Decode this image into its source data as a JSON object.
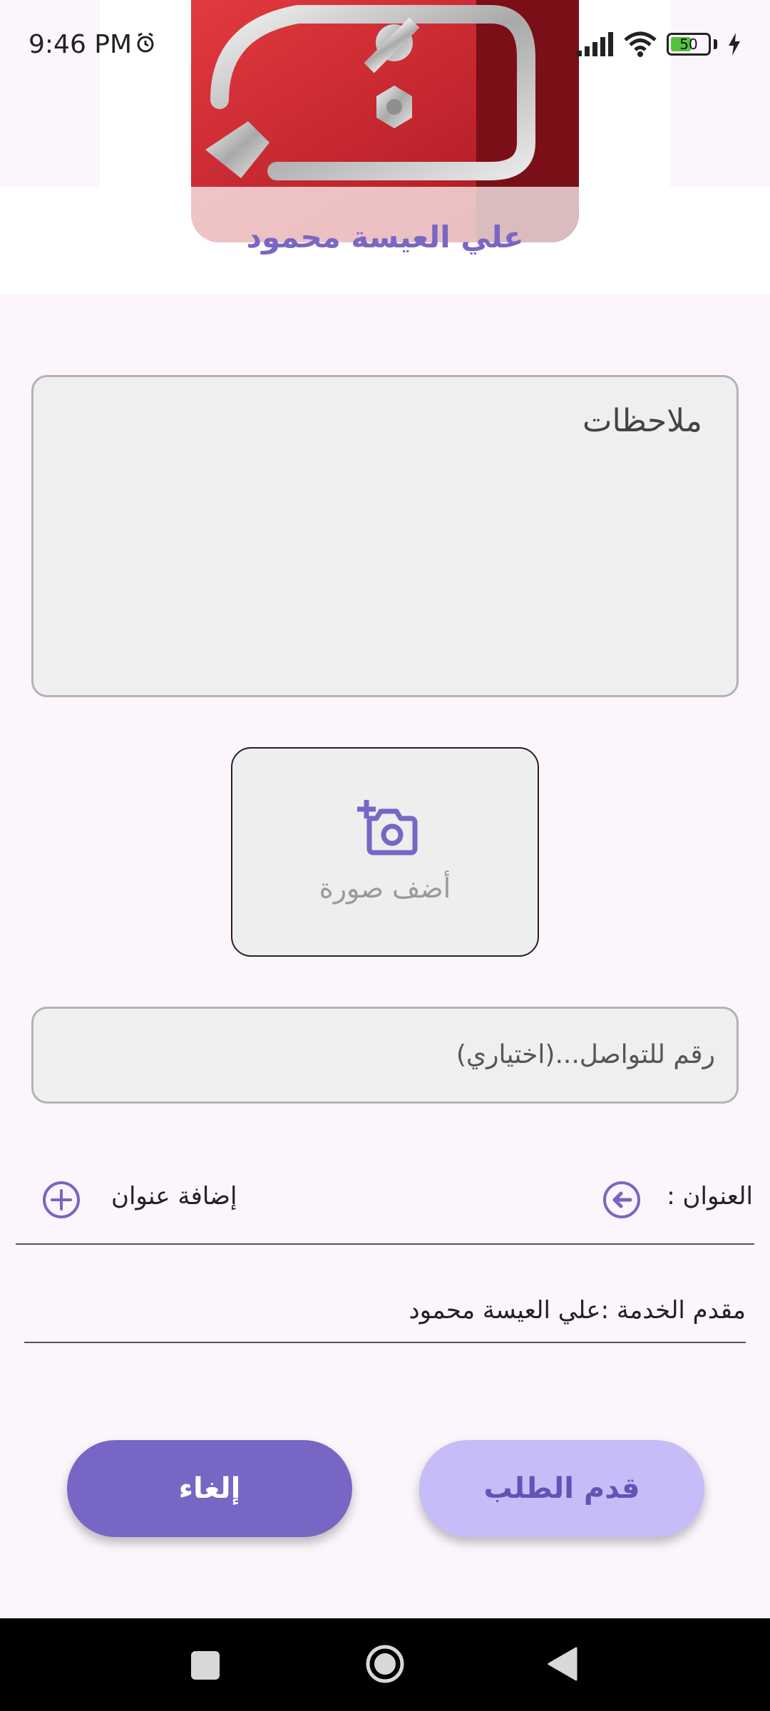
{
  "status_bar": {
    "time": "9:46 PM",
    "battery_level": "50"
  },
  "header": {
    "title": "علي العيسة محمود"
  },
  "notes": {
    "placeholder": "ملاحظات"
  },
  "add_photo": {
    "label": "أضف صورة"
  },
  "phone": {
    "placeholder": "رقم للتواصل...(اختياري)"
  },
  "address": {
    "label": "العنوان :",
    "add_label": "إضافة عنوان"
  },
  "provider": {
    "text": "مقدم الخدمة :علي العيسة محمود"
  },
  "buttons": {
    "cancel": "إلغاء",
    "submit": "قدم الطلب"
  },
  "colors": {
    "accent": "#7766c4",
    "accent_light": "#c6bcf8",
    "background": "#fcf5fc"
  }
}
